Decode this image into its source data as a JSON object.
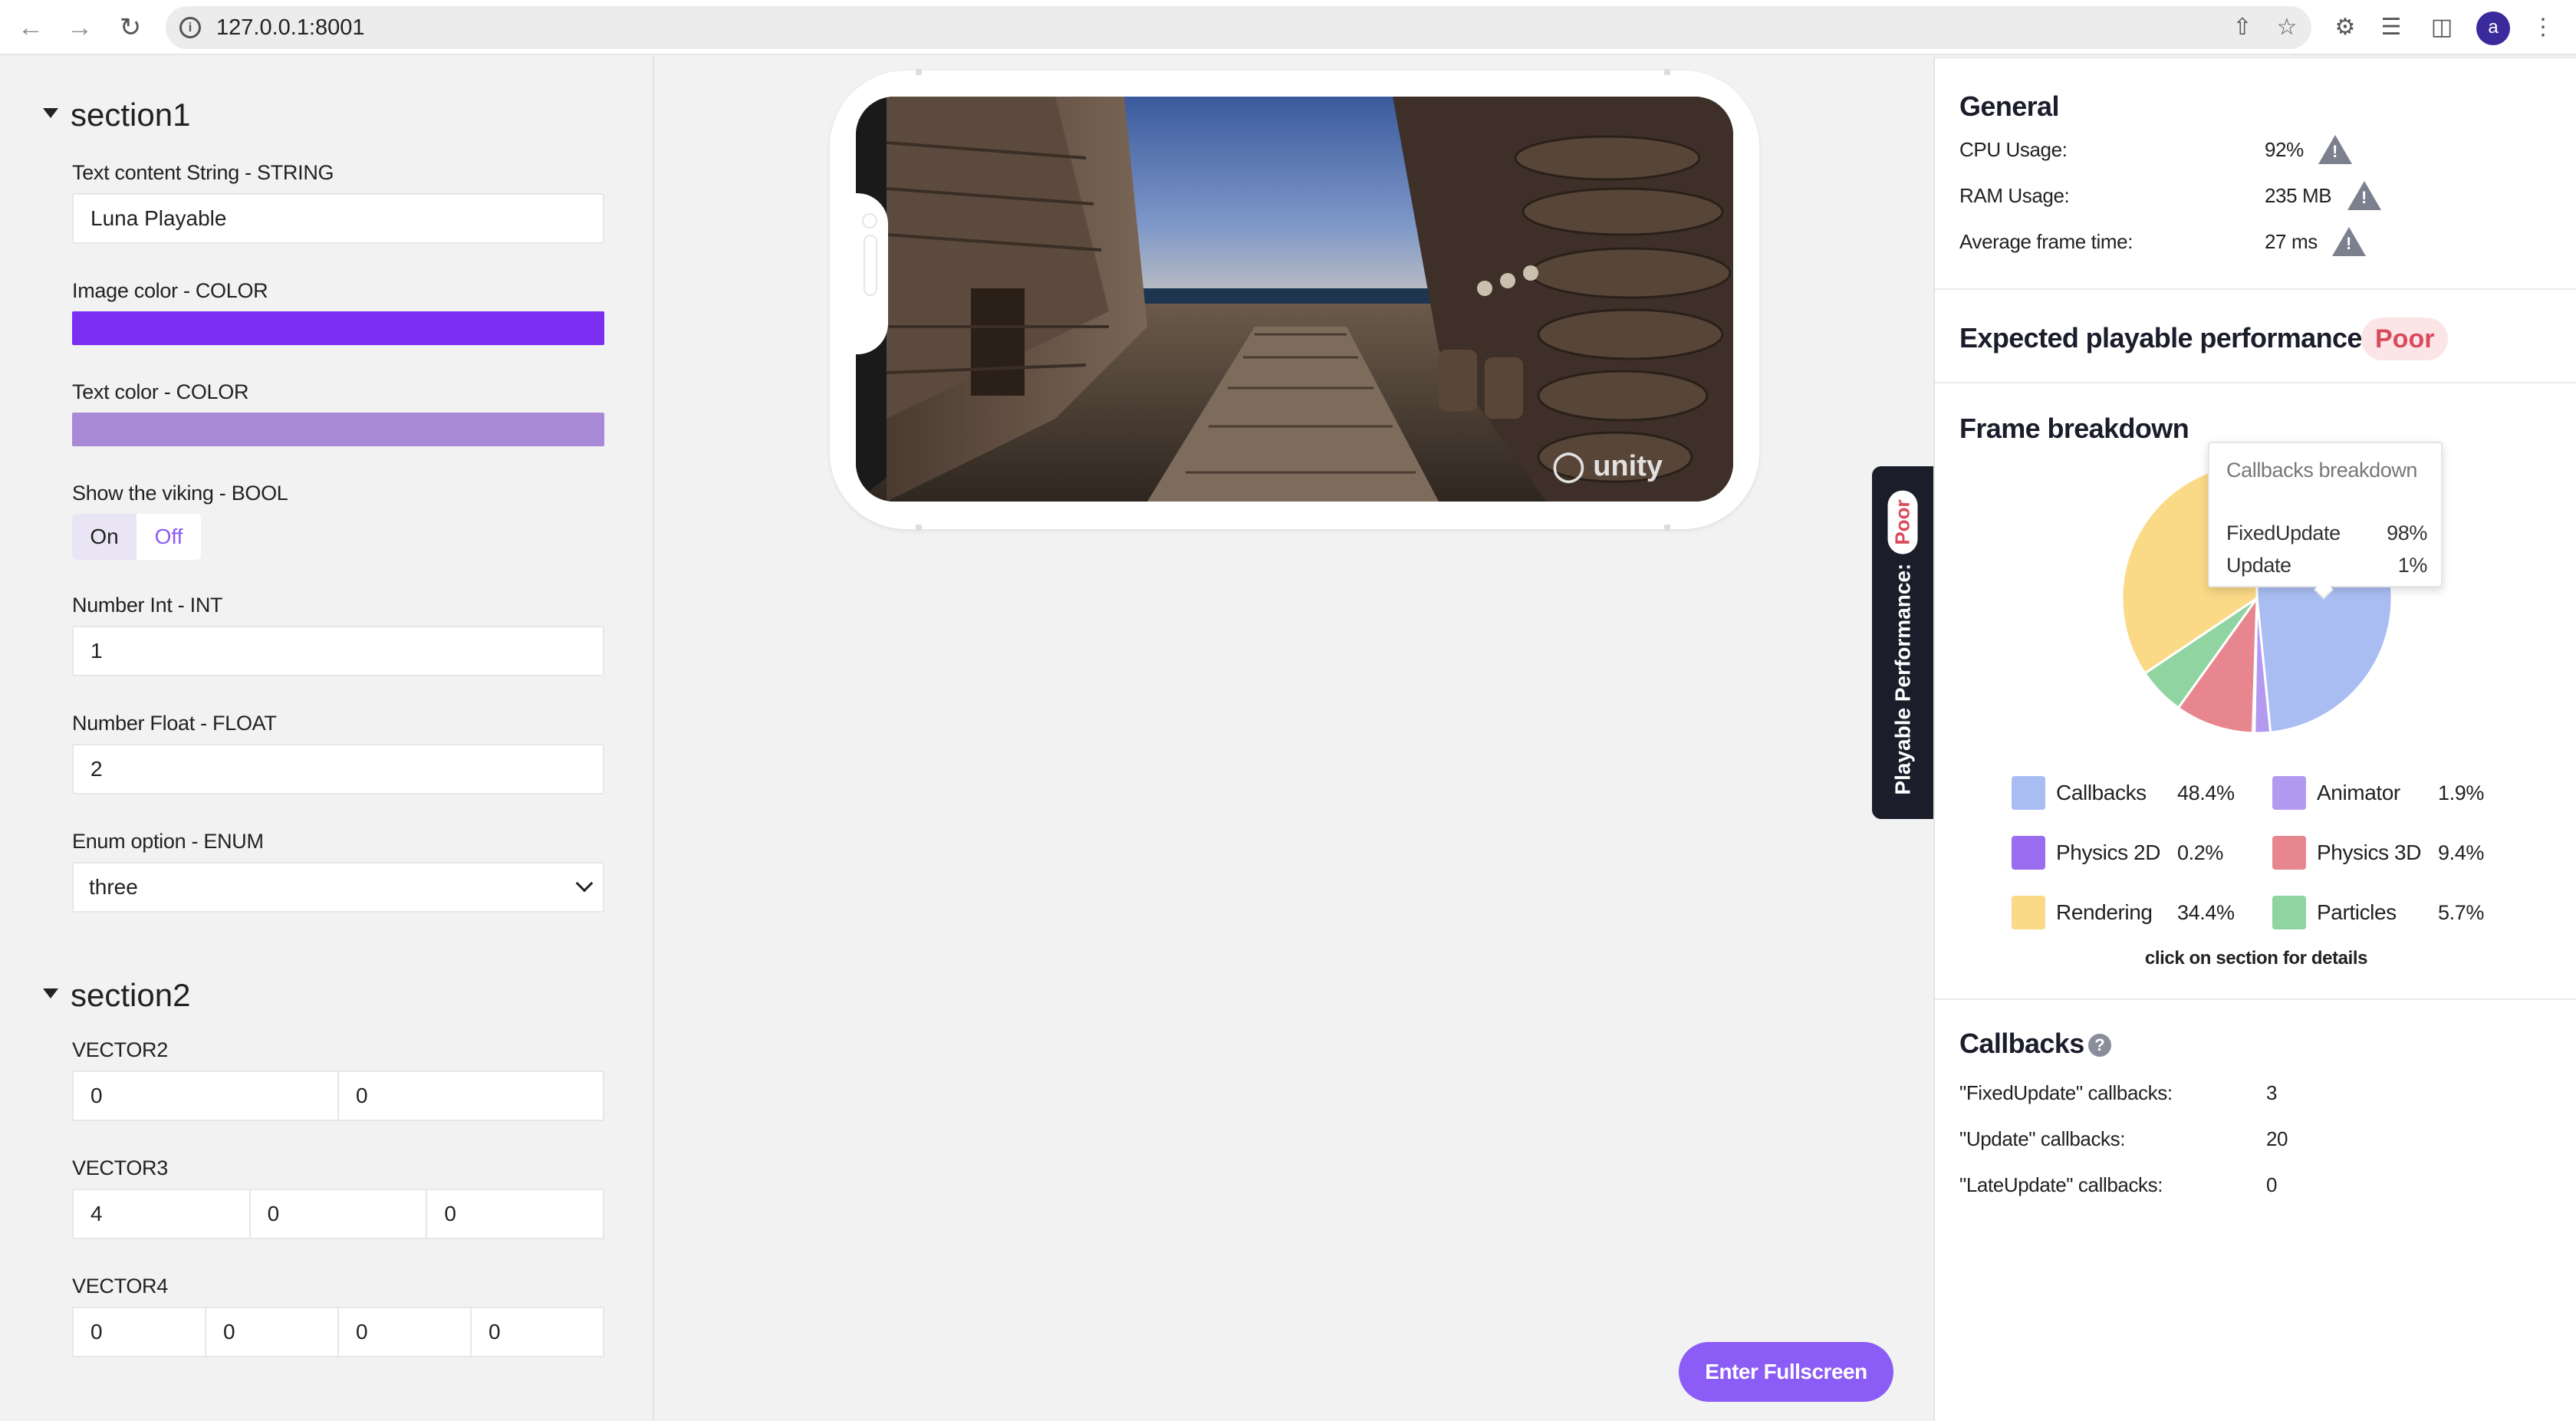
{
  "browser": {
    "url": "127.0.0.1:8001",
    "profile_initial": "a"
  },
  "left": {
    "section1": {
      "title": "section1",
      "text_label": "Text content String - STRING",
      "text_value": "Luna Playable",
      "image_color_label": "Image color - COLOR",
      "image_color": "#7b2ff2",
      "text_color_label": "Text color - COLOR",
      "text_color": "#a98ad8",
      "bool_label": "Show the viking - BOOL",
      "bool_on": "On",
      "bool_off": "Off",
      "int_label": "Number Int - INT",
      "int_value": "1",
      "float_label": "Number Float - FLOAT",
      "float_value": "2",
      "enum_label": "Enum option - ENUM",
      "enum_value": "three"
    },
    "section2": {
      "title": "section2",
      "vector2_label": "VECTOR2",
      "vector2": [
        "0",
        "0"
      ],
      "vector3_label": "VECTOR3",
      "vector3": [
        "4",
        "0",
        "0"
      ],
      "vector4_label": "VECTOR4",
      "vector4": [
        "0",
        "0",
        "0",
        "0"
      ]
    }
  },
  "center": {
    "unity_logo_text": "unity",
    "fullscreen_button": "Enter Fullscreen",
    "perf_tab_label": "Playable Performance:",
    "perf_tab_badge": "Poor"
  },
  "right": {
    "general_title": "General",
    "cpu_label": "CPU Usage:",
    "cpu_value": "92%",
    "ram_label": "RAM Usage:",
    "ram_value": "235 MB",
    "frame_label": "Average frame time:",
    "frame_value": "27 ms",
    "expected_title": "Expected playable performance",
    "expected_badge": "Poor",
    "breakdown_title": "Frame breakdown",
    "tooltip": {
      "title": "Callbacks breakdown",
      "rows": [
        {
          "name": "FixedUpdate",
          "value": "98%"
        },
        {
          "name": "Update",
          "value": "1%"
        }
      ]
    },
    "legend": [
      {
        "name": "Callbacks",
        "value": "48.4%",
        "color": "#a9bdf2"
      },
      {
        "name": "Animator",
        "value": "1.9%",
        "color": "#b39af0"
      },
      {
        "name": "Physics 2D",
        "value": "0.2%",
        "color": "#9a6cf0"
      },
      {
        "name": "Physics 3D",
        "value": "9.4%",
        "color": "#e8868f"
      },
      {
        "name": "Rendering",
        "value": "34.4%",
        "color": "#fad987"
      },
      {
        "name": "Particles",
        "value": "5.7%",
        "color": "#8fd4a1"
      }
    ],
    "click_hint": "click on section for details",
    "callbacks_title": "Callbacks",
    "callbacks": [
      {
        "label": "\"FixedUpdate\" callbacks:",
        "value": "3"
      },
      {
        "label": "\"Update\" callbacks:",
        "value": "20"
      },
      {
        "label": "\"LateUpdate\" callbacks:",
        "value": "0"
      }
    ]
  },
  "chart_data": {
    "type": "pie",
    "title": "Frame breakdown",
    "categories": [
      "Callbacks",
      "Animator",
      "Physics 2D",
      "Physics 3D",
      "Rendering",
      "Particles"
    ],
    "values": [
      48.4,
      1.9,
      0.2,
      9.4,
      34.4,
      5.7
    ],
    "colors": [
      "#a9bdf2",
      "#b39af0",
      "#9a6cf0",
      "#e8868f",
      "#fad987",
      "#8fd4a1"
    ]
  }
}
